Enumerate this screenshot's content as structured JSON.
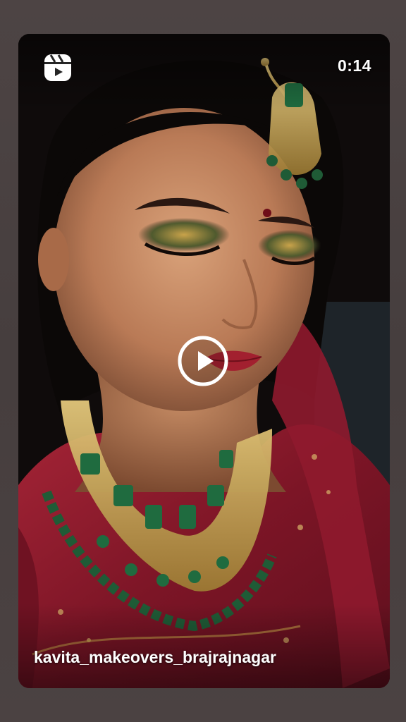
{
  "reel": {
    "duration": "0:14",
    "username": "kavita_makeovers_brajrajnagar"
  },
  "icons": {
    "reels": "reels-icon",
    "play": "play-icon"
  },
  "colors": {
    "background": "#4a4141",
    "overlay_text": "#ffffff",
    "saree_red": "#8e1b2a",
    "emerald": "#1f6b3f",
    "gold": "#c9a34a"
  }
}
